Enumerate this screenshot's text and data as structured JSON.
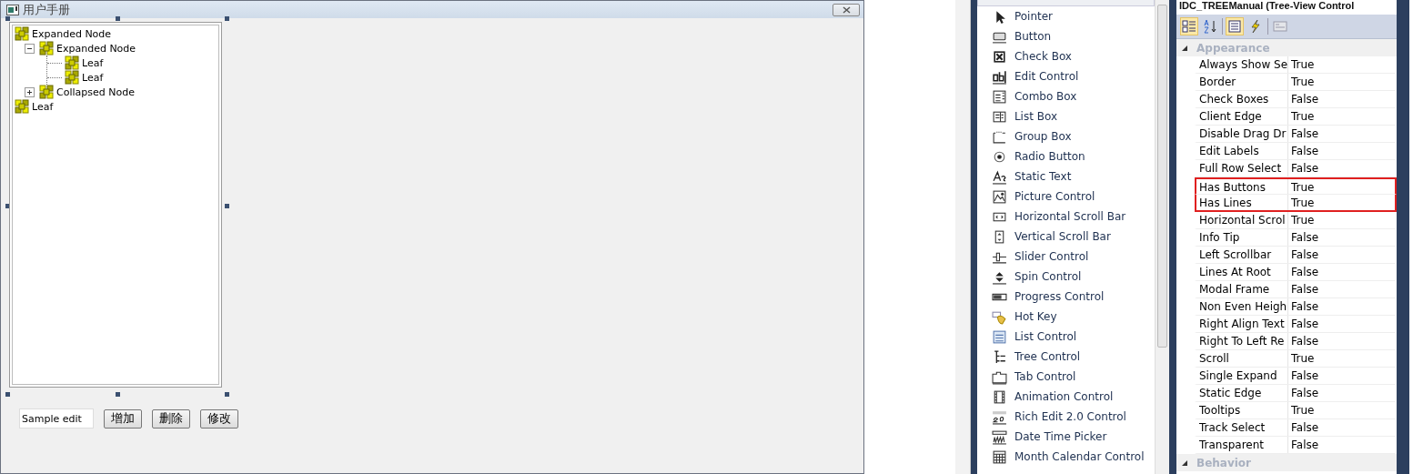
{
  "dialog": {
    "title": "用户手册",
    "tree": [
      {
        "label": "Expanded Node",
        "expanded": true,
        "children": [
          {
            "label": "Expanded Node",
            "expanded": true,
            "children": [
              {
                "label": "Leaf"
              },
              {
                "label": "Leaf"
              }
            ]
          },
          {
            "label": "Collapsed Node",
            "expanded": false
          }
        ]
      },
      {
        "label": "Leaf"
      }
    ],
    "edit": {
      "value": "Sample edit"
    },
    "buttons": [
      "增加",
      "删除",
      "修改"
    ]
  },
  "toolbox": {
    "items": [
      "Pointer",
      "Button",
      "Check Box",
      "Edit Control",
      "Combo Box",
      "List Box",
      "Group Box",
      "Radio Button",
      "Static Text",
      "Picture Control",
      "Horizontal Scroll Bar",
      "Vertical Scroll Bar",
      "Slider Control",
      "Spin Control",
      "Progress Control",
      "Hot Key",
      "List Control",
      "Tree Control",
      "Tab Control",
      "Animation Control",
      "Rich Edit 2.0 Control",
      "Date Time Picker",
      "Month Calendar Control"
    ]
  },
  "properties": {
    "title": "IDC_TREEManual (Tree-View Control",
    "categories": [
      {
        "name": "Appearance",
        "expanded": true,
        "rows": [
          {
            "name": "Always Show Se",
            "value": "True",
            "highlighted": false
          },
          {
            "name": "Border",
            "value": "True",
            "highlighted": false
          },
          {
            "name": "Check Boxes",
            "value": "False",
            "highlighted": false
          },
          {
            "name": "Client Edge",
            "value": "True",
            "highlighted": false
          },
          {
            "name": "Disable Drag Dr",
            "value": "False",
            "highlighted": false
          },
          {
            "name": "Edit Labels",
            "value": "False",
            "highlighted": false
          },
          {
            "name": "Full Row Select",
            "value": "False",
            "highlighted": false
          },
          {
            "name": "Has Buttons",
            "value": "True",
            "highlighted": true
          },
          {
            "name": "Has Lines",
            "value": "True",
            "highlighted": true
          },
          {
            "name": "Horizontal Scrol",
            "value": "True",
            "highlighted": false
          },
          {
            "name": "Info Tip",
            "value": "False",
            "highlighted": false
          },
          {
            "name": "Left Scrollbar",
            "value": "False",
            "highlighted": false
          },
          {
            "name": "Lines At Root",
            "value": "False",
            "highlighted": false
          },
          {
            "name": "Modal Frame",
            "value": "False",
            "highlighted": false
          },
          {
            "name": "Non Even Heigh",
            "value": "False",
            "highlighted": false
          },
          {
            "name": "Right Align Text",
            "value": "False",
            "highlighted": false
          },
          {
            "name": "Right To Left Re",
            "value": "False",
            "highlighted": false
          },
          {
            "name": "Scroll",
            "value": "True",
            "highlighted": false
          },
          {
            "name": "Single Expand",
            "value": "False",
            "highlighted": false
          },
          {
            "name": "Static Edge",
            "value": "False",
            "highlighted": false
          },
          {
            "name": "Tooltips",
            "value": "True",
            "highlighted": false
          },
          {
            "name": "Track Select",
            "value": "False",
            "highlighted": false
          },
          {
            "name": "Transparent",
            "value": "False",
            "highlighted": false
          }
        ]
      },
      {
        "name": "Behavior",
        "expanded": true
      }
    ]
  }
}
